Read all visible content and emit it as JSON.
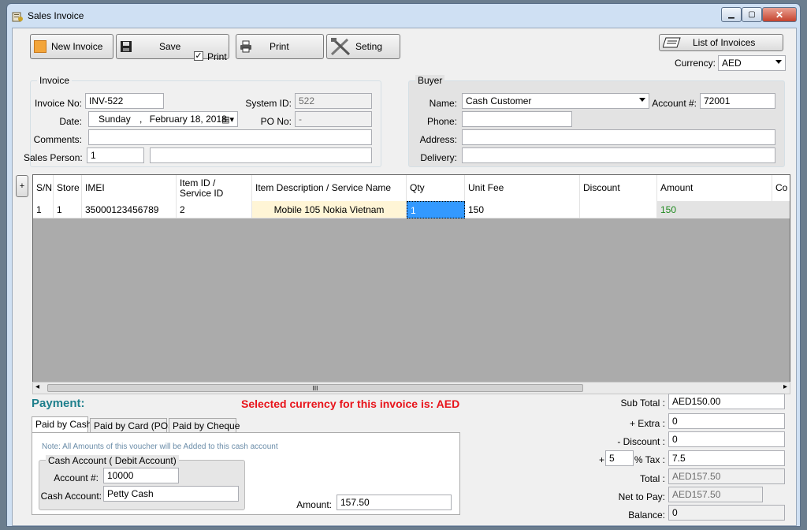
{
  "window": {
    "title": "Sales Invoice"
  },
  "toolbar": {
    "new_invoice": "New Invoice",
    "save": "Save",
    "print_checkbox": "Print",
    "print_checked": true,
    "print": "Print",
    "setting": "Seting",
    "list_of_invoices": "List of Invoices",
    "currency_label": "Currency:",
    "currency_value": "AED"
  },
  "invoice": {
    "group_title": "Invoice",
    "invoice_no_label": "Invoice No:",
    "invoice_no": "INV-522",
    "system_id_label": "System ID:",
    "system_id": "522",
    "date_label": "Date:",
    "date_weekday": "Sunday",
    "date_rest": "February  18, 2018",
    "po_no_label": "PO No:",
    "po_no": "-",
    "comments_label": "Comments:",
    "comments": "",
    "sales_person_label": "Sales Person:",
    "sales_person": "1",
    "sales_person_name": ""
  },
  "buyer": {
    "group_title": "Buyer",
    "name_label": "Name:",
    "name": "Cash Customer",
    "account_label": "Account #:",
    "account": "72001",
    "phone_label": "Phone:",
    "phone": "",
    "address_label": "Address:",
    "address": "",
    "delivery_label": "Delivery:",
    "delivery": ""
  },
  "grid": {
    "expand_button": "+",
    "columns": [
      "S/N",
      "Store",
      "IMEI",
      "Item ID / Service ID",
      "Item Description  / Service Name",
      "Qty",
      "Unit Fee",
      "Discount",
      "Amount",
      "Co"
    ],
    "column_id_line1": "Item ID /",
    "column_id_line2": "Service ID",
    "rows": [
      {
        "sn": "1",
        "store": "1",
        "imei": "35000123456789",
        "item_id": "2",
        "description": "Mobile 105 Nokia Vietnam",
        "qty": "1",
        "unit_fee": "150",
        "discount": "",
        "amount": "150",
        "co": ""
      }
    ],
    "scroll_grip": "III"
  },
  "payment": {
    "heading": "Payment:",
    "selected_currency_msg": "Selected currency for this invoice is: AED",
    "tabs": [
      "Paid by Cash",
      "Paid by Card (POS)",
      "Paid by Cheque"
    ],
    "active_tab": 0,
    "note": "Note: All Amounts of this voucher will be Added to  this cash account",
    "cash_group_title": "Cash Account ( Debit Account)",
    "account_label": "Account #:",
    "account": "10000",
    "cash_account_label": "Cash Account:",
    "cash_account": "Petty Cash",
    "amount_label": "Amount:",
    "amount": "157.50"
  },
  "totals": {
    "sub_total_label": "Sub Total :",
    "sub_total": "AED150.00",
    "extra_label": "+ Extra :",
    "extra": "0",
    "discount_label": "- Discount :",
    "discount": "0",
    "tax_plus": "+",
    "tax_rate": "5",
    "tax_label": "% Tax :",
    "tax": "7.5",
    "total_label": "Total :",
    "total": "AED157.50",
    "net_label": "Net to Pay:",
    "net": "AED157.50",
    "balance_label": "Balance:",
    "balance": "0"
  },
  "colors": {
    "currency_message": "#e8141b",
    "payment_heading": "#1e7f8c",
    "amount_value": "#1f8a1f",
    "description_cell_bg": "#fff5d6",
    "selected_cell_bg": "#3399ff"
  }
}
